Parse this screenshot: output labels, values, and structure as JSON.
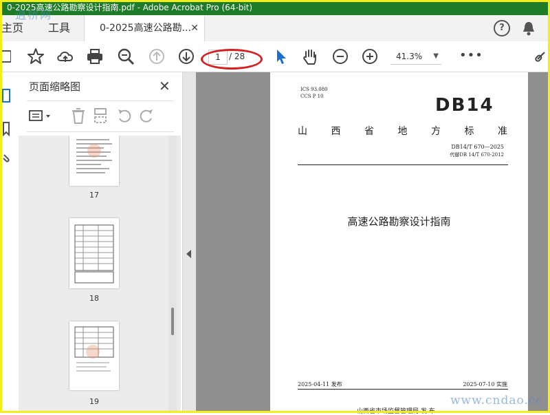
{
  "window": {
    "title": "0-2025高速公路勘察设计指南.pdf - Adobe Acrobat Pro (64-bit)",
    "titlebar_color": "#1e7c29"
  },
  "watermark": {
    "top": "逍桥网",
    "bottom": "www.cndao.cc"
  },
  "tabs": {
    "home": "主页",
    "tools": "工具",
    "document": "0-2025高速公路勘...",
    "close_glyph": "✕"
  },
  "header_icons": {
    "help": "?",
    "help_icon": "help-icon",
    "bell_icon": "bell-icon"
  },
  "toolbar": {
    "current_page": "1",
    "total_pages": "/ 28",
    "zoom": "41.3%",
    "more": "•••",
    "icons": [
      "save-icon",
      "star-icon",
      "cloud-upload-icon",
      "print-icon",
      "zoom-search-icon",
      "page-up-icon",
      "page-down-icon",
      "select-cursor-icon",
      "hand-icon",
      "zoom-out-icon",
      "zoom-in-icon",
      "link-icon"
    ]
  },
  "panel": {
    "title": "页面缩略图",
    "close": "✕",
    "thumbnails": [
      {
        "label": "17"
      },
      {
        "label": "18"
      },
      {
        "label": "19"
      }
    ]
  },
  "document_page": {
    "ics_line1": "ICS  93.080",
    "ics_line2": "CCS  P  10",
    "db_mark": "DB14",
    "standard_chars": [
      "山",
      "西",
      "省",
      "地",
      "方",
      "标",
      "准"
    ],
    "code": "DB14/T  670—2025",
    "replaces": "代替DB 14/T 670-2012",
    "title": "高速公路勘察设计指南",
    "publish_date": "2025-04-11 发布",
    "implement_date": "2025-07-10 实施",
    "issuer": "山西省市场监督管理局    发 布"
  },
  "colors": {
    "accent_blue": "#1b6fd1",
    "annotation_red": "#d42020",
    "highlight_frame": "#f3ee16"
  }
}
